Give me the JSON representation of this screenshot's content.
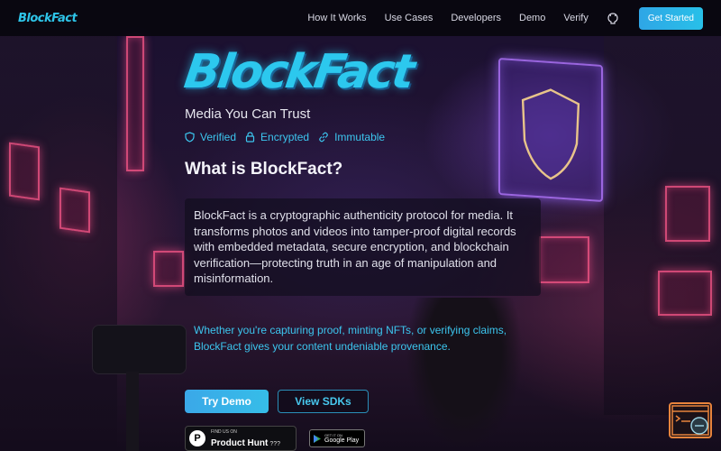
{
  "nav": {
    "logo": "BlockFact",
    "links": [
      "How It Works",
      "Use Cases",
      "Developers",
      "Demo",
      "Verify"
    ],
    "github_icon": "github-icon",
    "cta": "Get Started"
  },
  "hero": {
    "logo": "BlockFact",
    "tagline": "Media You Can Trust",
    "badges": [
      {
        "icon": "shield-icon",
        "label": "Verified"
      },
      {
        "icon": "lock-icon",
        "label": "Encrypted"
      },
      {
        "icon": "link-icon",
        "label": "Immutable"
      }
    ],
    "heading": "What is BlockFact?",
    "description": "BlockFact is a cryptographic authenticity protocol for media. It transforms photos and videos into tamper-proof digital records with embedded metadata, secure encryption, and blockchain verification—protecting truth in an age of manipulation and misinformation.",
    "highlight": "Whether you're capturing proof, minting NFTs, or verifying claims, BlockFact gives your content undeniable provenance.",
    "buttons": {
      "primary": "Try Demo",
      "secondary": "View SDKs"
    }
  },
  "badges_store": {
    "product_hunt": {
      "small": "FIND US ON",
      "big": "Product Hunt",
      "count": "???"
    },
    "google_play": {
      "small": "GET IT ON",
      "big": "Google Play"
    }
  },
  "colors": {
    "accent": "#2cc8ee",
    "cta": "#2fa6e6",
    "chat_border": "#e8843c"
  }
}
